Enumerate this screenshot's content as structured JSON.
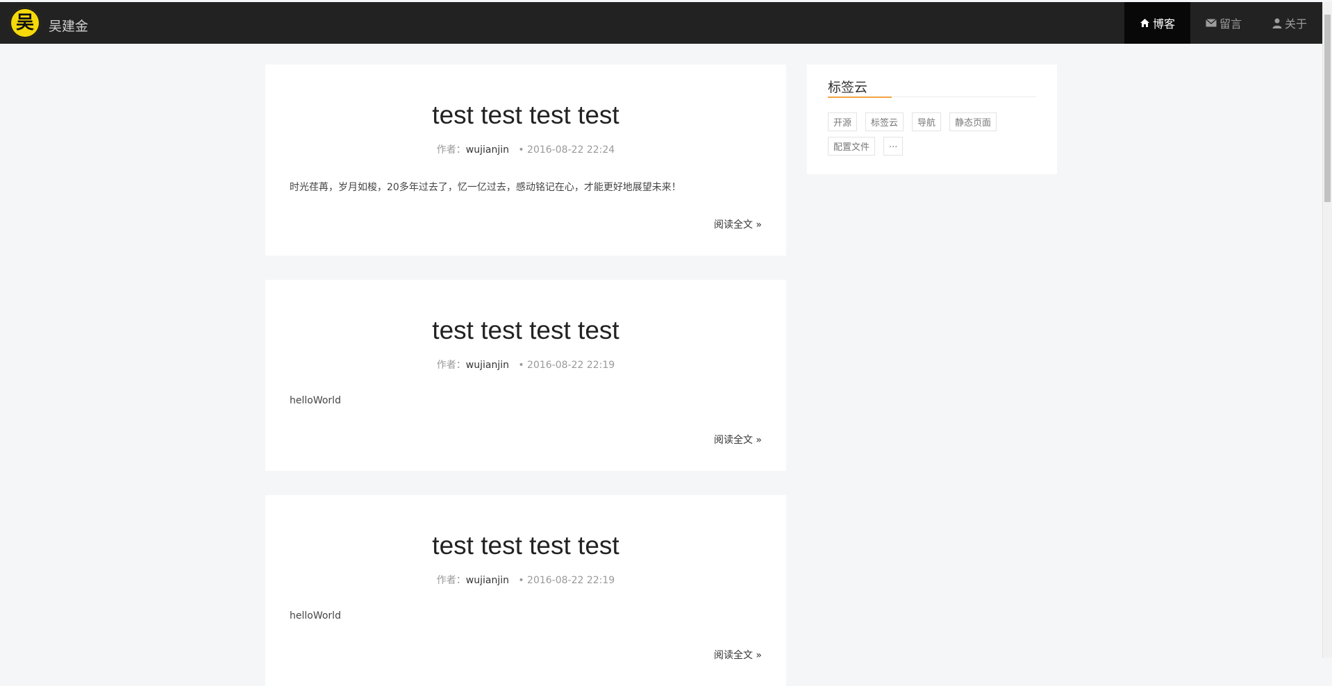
{
  "header": {
    "logo_char": "吴",
    "brand": "吴建金",
    "nav": [
      {
        "label": "博客",
        "icon": "home-icon",
        "active": true
      },
      {
        "label": "留言",
        "icon": "envelope-icon",
        "active": false
      },
      {
        "label": "关于",
        "icon": "user-icon",
        "active": false
      }
    ]
  },
  "posts": [
    {
      "title": "test test test test",
      "author_label": "作者：",
      "author": "wujianjin",
      "date": "• 2016-08-22 22:24",
      "excerpt": "时光荏苒，岁月如梭，20多年过去了，忆一亿过去，感动铭记在心，才能更好地展望未来！",
      "read_more": "阅读全文 »"
    },
    {
      "title": "test test test test",
      "author_label": "作者：",
      "author": "wujianjin",
      "date": "• 2016-08-22 22:19",
      "excerpt": "helloWorld",
      "read_more": "阅读全文 »"
    },
    {
      "title": "test test test test",
      "author_label": "作者：",
      "author": "wujianjin",
      "date": "• 2016-08-22 22:19",
      "excerpt": "helloWorld",
      "read_more": "阅读全文 »"
    }
  ],
  "sidebar": {
    "tag_cloud_title": "标签云",
    "tags": [
      "开源",
      "标签云",
      "导航",
      "静态页面",
      "配置文件",
      "..."
    ]
  },
  "colors": {
    "navbar": "#222222",
    "nav_active": "#080808",
    "accent": "#f3a33f",
    "logo": "#f5d90a"
  }
}
